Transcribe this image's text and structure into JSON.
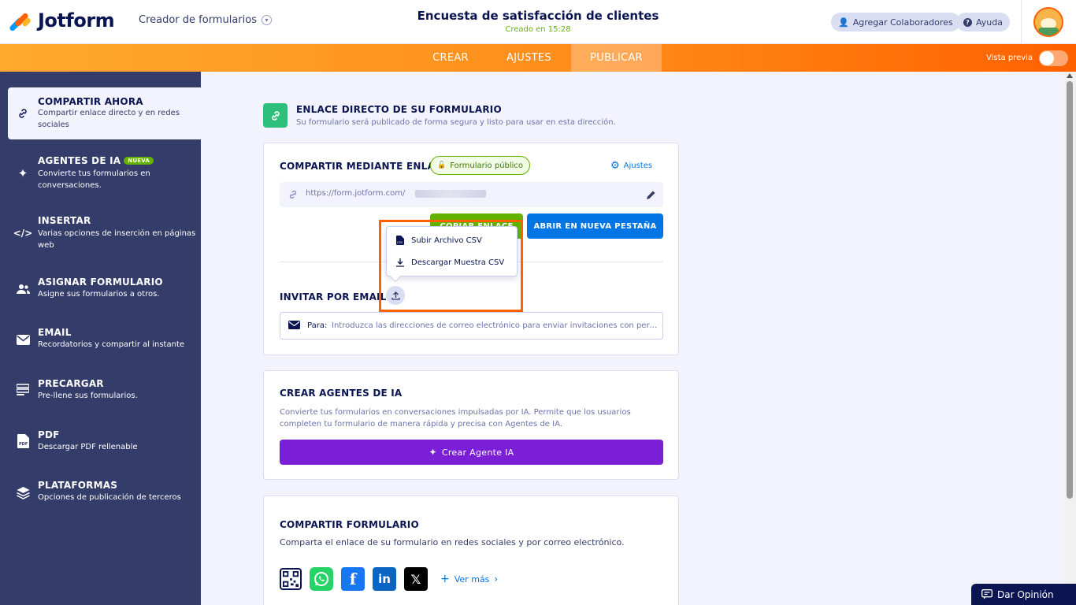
{
  "header": {
    "logo_text": "Jotform",
    "builder_label": "Creador de formularios",
    "form_title": "Encuesta de satisfacción de clientes",
    "created_text": "Creado en 15:28",
    "collaborators_label": "Agregar Colaboradores",
    "help_label": "Ayuda"
  },
  "nav": {
    "tabs": [
      {
        "label": "CREAR",
        "active": false
      },
      {
        "label": "AJUSTES",
        "active": false
      },
      {
        "label": "PUBLICAR",
        "active": true
      }
    ],
    "preview_label": "Vista previa",
    "preview_on": false
  },
  "sidebar": {
    "items": [
      {
        "title": "COMPARTIR AHORA",
        "desc": "Compartir enlace directo y en redes sociales",
        "icon": "link-icon",
        "active": true
      },
      {
        "title": "AGENTES DE IA",
        "badge": "NUEVA",
        "desc": "Convierte tus formularios en conversaciones.",
        "icon": "sparkle-icon"
      },
      {
        "title": "INSERTAR",
        "desc": "Varias opciones de inserción en páginas web",
        "icon": "code-icon"
      },
      {
        "title": "ASIGNAR FORMULARIO",
        "desc": "Asigne sus formularios a otros.",
        "icon": "users-icon"
      },
      {
        "title": "EMAIL",
        "desc": "Recordatorios y compartir al instante",
        "icon": "mail-icon"
      },
      {
        "title": "PRECARGAR",
        "desc": "Pre-llene sus formularios.",
        "icon": "list-icon"
      },
      {
        "title": "PDF",
        "desc": "Descargar PDF rellenable",
        "icon": "pdf-icon"
      },
      {
        "title": "PLATAFORMAS",
        "desc": "Opciones de publicación de terceros",
        "icon": "layers-icon"
      }
    ]
  },
  "direct_link": {
    "title": "ENLACE DIRECTO DE SU FORMULARIO",
    "subtitle": "Su formulario será publicado de forma segura y listo para usar en esta dirección."
  },
  "share_link": {
    "title": "COMPARTIR MEDIANTE ENLACE",
    "public_badge": "Formulario público",
    "settings_label": "Ajustes",
    "url": "https://form.jotform.com/",
    "copy_button": "COPIAR ENLACE",
    "open_button": "ABRIR EN NUEVA PESTAÑA",
    "invite_title": "INVITAR POR EMAIL",
    "email_to_label": "Para:",
    "email_placeholder": "Introduzca las direcciones de correo electrónico para enviar invitaciones con permiso de acceso"
  },
  "dropdown": {
    "upload_csv": "Subir Archivo CSV",
    "download_sample": "Descargar Muestra CSV"
  },
  "ai_agents": {
    "title": "CREAR AGENTES DE IA",
    "desc": "Convierte tus formularios en conversaciones impulsadas por IA. Permite que los usuarios completen tu formulario de manera rápida y precisa con Agentes de IA.",
    "button": "Crear Agente IA"
  },
  "share_form": {
    "title": "COMPARTIR FORMULARIO",
    "desc": "Comparta el enlace de su formulario en redes sociales y por correo electrónico.",
    "more_label": "Ver más"
  },
  "feedback_label": "Dar Opinión",
  "colors": {
    "navy": "#0a1551",
    "sidebar": "#343c6a",
    "orange": "#ff6100",
    "green": "#64b200",
    "blue": "#0075e3",
    "purple": "#7b1fd6"
  }
}
